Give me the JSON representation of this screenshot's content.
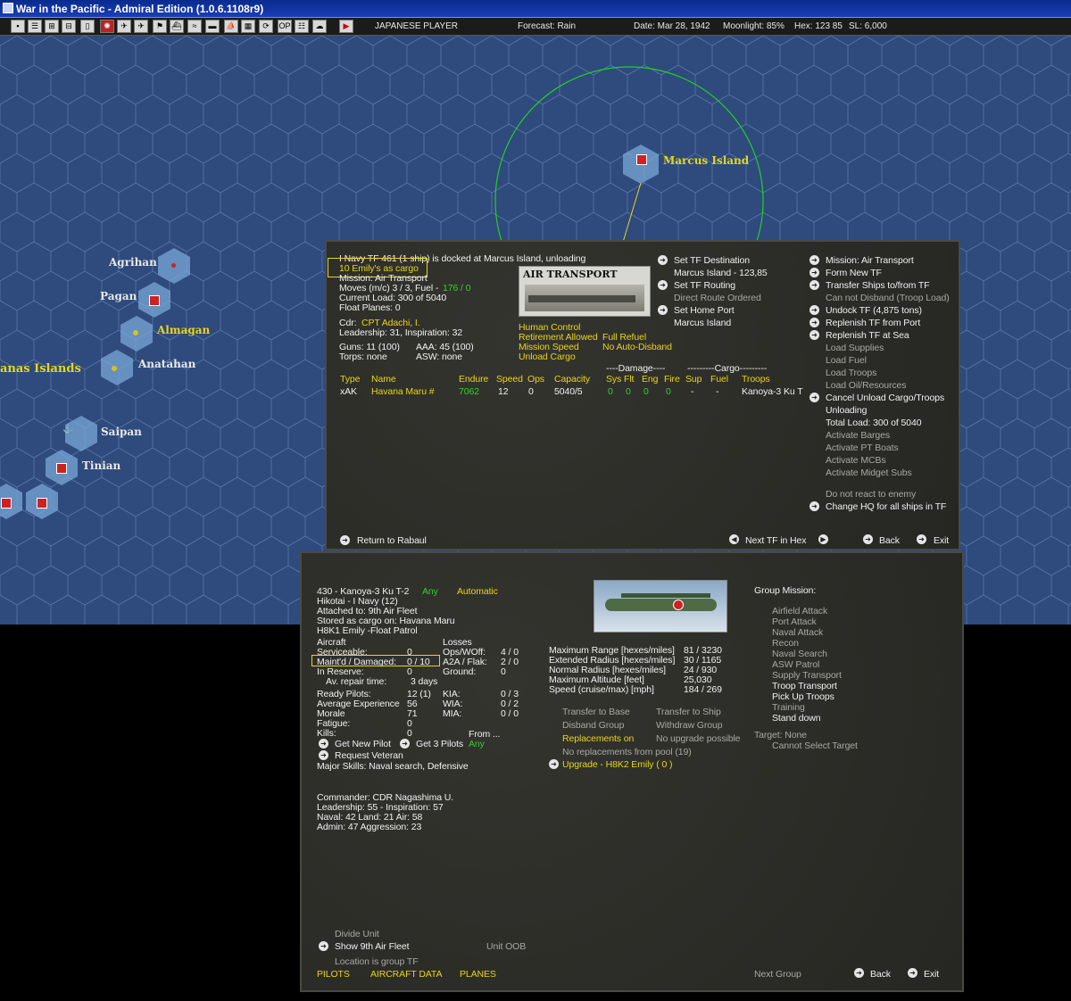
{
  "window": {
    "title": "War in the Pacific - Admiral Edition (1.0.6.1108r9)"
  },
  "status": {
    "player": "JAPANESE PLAYER",
    "forecast": "Forecast: Rain",
    "date": "Date: Mar 28, 1942",
    "moonlight": "Moonlight: 85%",
    "hex": "Hex: 123 85",
    "sl": "SL: 6,000"
  },
  "map": {
    "islands": [
      "Marcus Island",
      "Agrihan",
      "Pagan",
      "Almagan",
      "Anatahan",
      "anas Islands",
      "Saipan",
      "Tinian"
    ]
  },
  "tf": {
    "header": "I Navy TF 461 (1 ship) is docked at Marcus Island, unloading",
    "cargo": "10 Emily's as cargo",
    "mission": "Mission: Air Transport",
    "moves": "Moves (m/c) 3 / 3, Fuel -",
    "fuel": "176 / 0",
    "load": "Current Load: 300 of 5040",
    "float": "Float Planes: 0",
    "cdr_label": "Cdr:",
    "cdr": "CPT Adachi, I.",
    "leadership": "Leadership: 31, Inspiration: 32",
    "guns": "Guns: 11 (100)",
    "aaa": "AAA: 45 (100)",
    "torps": "Torps: none",
    "asw": "ASW: none",
    "image_caption": "AIR TRANSPORT",
    "options": [
      "Human Control",
      "Retirement Allowed",
      "Mission Speed",
      "Unload Cargo",
      "Full Refuel",
      "No Auto-Disband"
    ],
    "dest_btn": "Set TF Destination",
    "dest": "Marcus Island - 123,85",
    "routing_btn": "Set TF Routing",
    "routing": "Direct Route Ordered",
    "home_btn": "Set Home Port",
    "home": "Marcus Island",
    "table": {
      "group1": "----Damage----",
      "group2": "---------Cargo---------",
      "headers": [
        "Type",
        "Name",
        "Endure",
        "Speed",
        "Ops",
        "Capacity",
        "Sys",
        "Flt",
        "Eng",
        "Fire",
        "Sup",
        "Fuel",
        "Troops"
      ],
      "row": [
        "xAK",
        "Havana Maru #",
        "7062",
        "12",
        "0",
        "5040/5",
        "0",
        "0",
        "0",
        "0",
        "-",
        "-",
        "Kanoya-3 Ku T"
      ]
    },
    "right": [
      "Mission: Air Transport",
      "Form New TF",
      "Transfer Ships to/from TF",
      "Can not Disband (Troop Load)",
      "Undock TF (4,875 tons)",
      "Replenish TF from Port",
      "Replenish TF at Sea",
      "Load Supplies",
      "Load Fuel",
      "Load Troops",
      "Load Oil/Resources",
      "Cancel Unload Cargo/Troops",
      "Unloading",
      "Total Load: 300 of 5040",
      "Activate Barges",
      "Activate PT Boats",
      "Activate MCBs",
      "Activate Midget Subs",
      "Do not react to enemy",
      "Change HQ for all ships in TF"
    ],
    "return": "Return to Rabaul",
    "next": "Next TF in Hex",
    "back": "Back",
    "exit": "Exit"
  },
  "air": {
    "unit": "430 - Kanoya-3 Ku T-2",
    "any": "Any",
    "auto": "Automatic",
    "hikotai": "Hikotai - I Navy (12)",
    "attached": "Attached to: 9th Air Fleet",
    "stored": "Stored as cargo on: Havana Maru",
    "type": "H8K1 Emily -Float Patrol",
    "aircraft": "Aircraft",
    "losses": "Losses",
    "serv_l": "Serviceable:",
    "serv_v": "0",
    "ops_l": "Ops/WOff:",
    "ops_v": "4 / 0",
    "maint_l": "Maint'd / Damaged:",
    "maint_v": "0 / 10",
    "a2a_l": "A2A / Flak:",
    "a2a_v": "2 / 0",
    "reserve_l": "In Reserve:",
    "reserve_v": "0",
    "ground_l": "Ground:",
    "ground_v": "0",
    "repair_l": "Av. repair time:",
    "repair_v": "3 days",
    "ready_l": "Ready Pilots:",
    "ready_v": "12 (1)",
    "kia_l": "KIA:",
    "kia_v": "0 / 3",
    "exp_l": "Average Experience",
    "exp_v": "56",
    "wia_l": "WIA:",
    "wia_v": "0 / 2",
    "morale_l": "Morale",
    "morale_v": "71",
    "mia_l": "MIA:",
    "mia_v": "0 / 0",
    "fatigue_l": "Fatigue:",
    "fatigue_v": "0",
    "kills_l": "Kills:",
    "kills_v": "0",
    "newpilot": "Get New Pilot",
    "get3": "Get 3 Pilots",
    "from": "From ...",
    "from_any": "Any",
    "veteran": "Request Veteran",
    "skills": "Major Skills: Naval search, Defensive",
    "specs": [
      [
        "Maximum Range [hexes/miles]",
        "81 / 3230"
      ],
      [
        "Extended Radius [hexes/miles]",
        "30 / 1165"
      ],
      [
        "Normal Radius [hexes/miles]",
        "24 / 930"
      ],
      [
        "Maximum Altitude [feet]",
        "25,030"
      ],
      [
        "Speed (cruise/max) [mph]",
        "184 / 269"
      ]
    ],
    "transfer_base": "Transfer to Base",
    "transfer_ship": "Transfer to Ship",
    "disband": "Disband Group",
    "withdraw": "Withdraw Group",
    "repl_on": "Replacements on",
    "no_upgrade": "No upgrade possible",
    "no_repl": "No replacements from pool (19)",
    "upgrade": "Upgrade - H8K2 Emily  ( 0 )",
    "group_mission": "Group Mission:",
    "missions": [
      "Airfield Attack",
      "Port Attack",
      "Naval Attack",
      "Recon",
      "Naval Search",
      "ASW Patrol",
      "Supply Transport",
      "Troop Transport",
      "Pick Up Troops",
      "Training",
      "Stand down"
    ],
    "target": "Target: None",
    "cannot": "Cannot Select Target",
    "commander": "Commander:  CDR Nagashima U.",
    "cmd_lead": "Leadership: 55 - Inspiration: 57",
    "cmd_nla": " Naval: 42  Land: 21  Air: 58",
    "cmd_aa": " Admin: 47  Aggression: 23",
    "divide": "Divide Unit",
    "show": "Show 9th Air Fleet",
    "oob": "Unit OOB",
    "location": "Location is group TF",
    "tabs": [
      "PILOTS",
      "AIRCRAFT DATA",
      "PLANES"
    ],
    "next_group": "Next Group",
    "back": "Back",
    "exit": "Exit"
  }
}
